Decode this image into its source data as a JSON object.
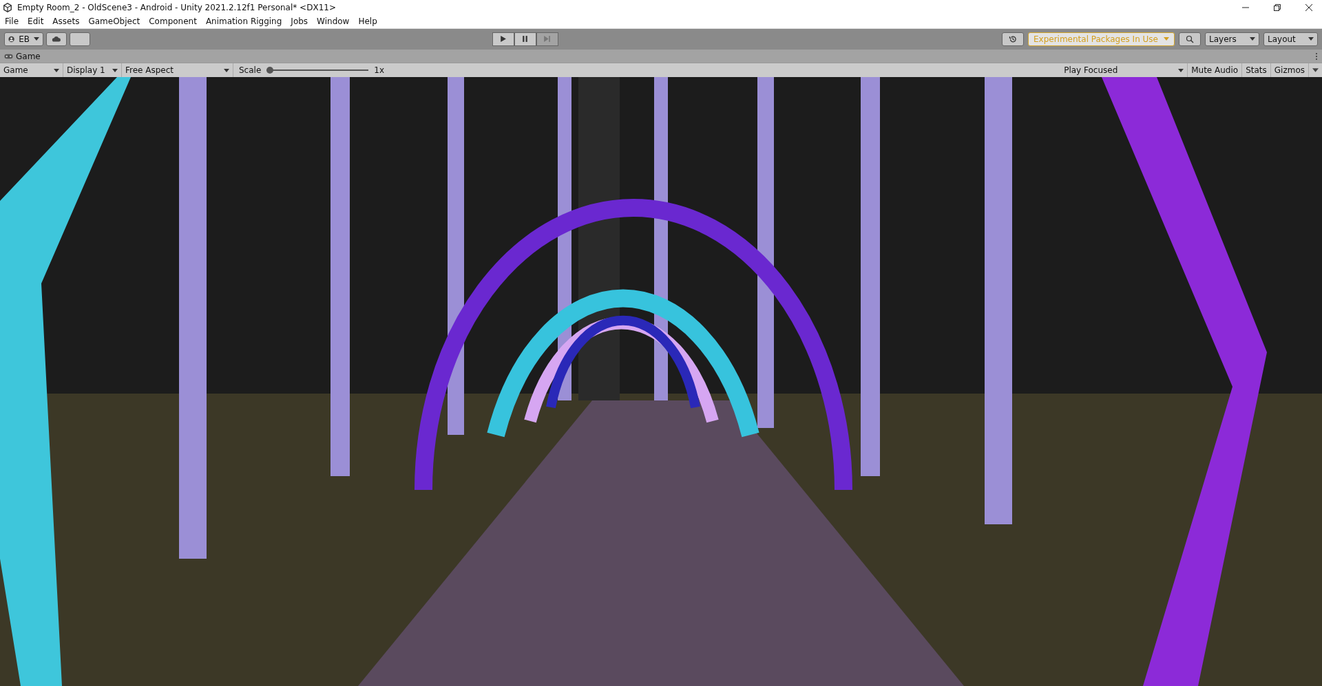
{
  "window": {
    "title": "Empty Room_2 - OldScene3 - Android - Unity 2021.2.12f1 Personal* <DX11>"
  },
  "menu": [
    "File",
    "Edit",
    "Assets",
    "GameObject",
    "Component",
    "Animation Rigging",
    "Jobs",
    "Window",
    "Help"
  ],
  "toolbar": {
    "account": "EB",
    "experimental": "Experimental Packages In Use",
    "layers": "Layers",
    "layout": "Layout"
  },
  "panel": {
    "tab": "Game"
  },
  "game_toolbar": {
    "view": "Game",
    "display": "Display 1",
    "aspect": "Free Aspect",
    "scale_label": "Scale",
    "scale": {
      "level": 0
    },
    "scale_value": "1x",
    "play_mode": "Play Focused",
    "toggles": [
      "Mute Audio",
      "Stats",
      "Gizmos"
    ]
  }
}
